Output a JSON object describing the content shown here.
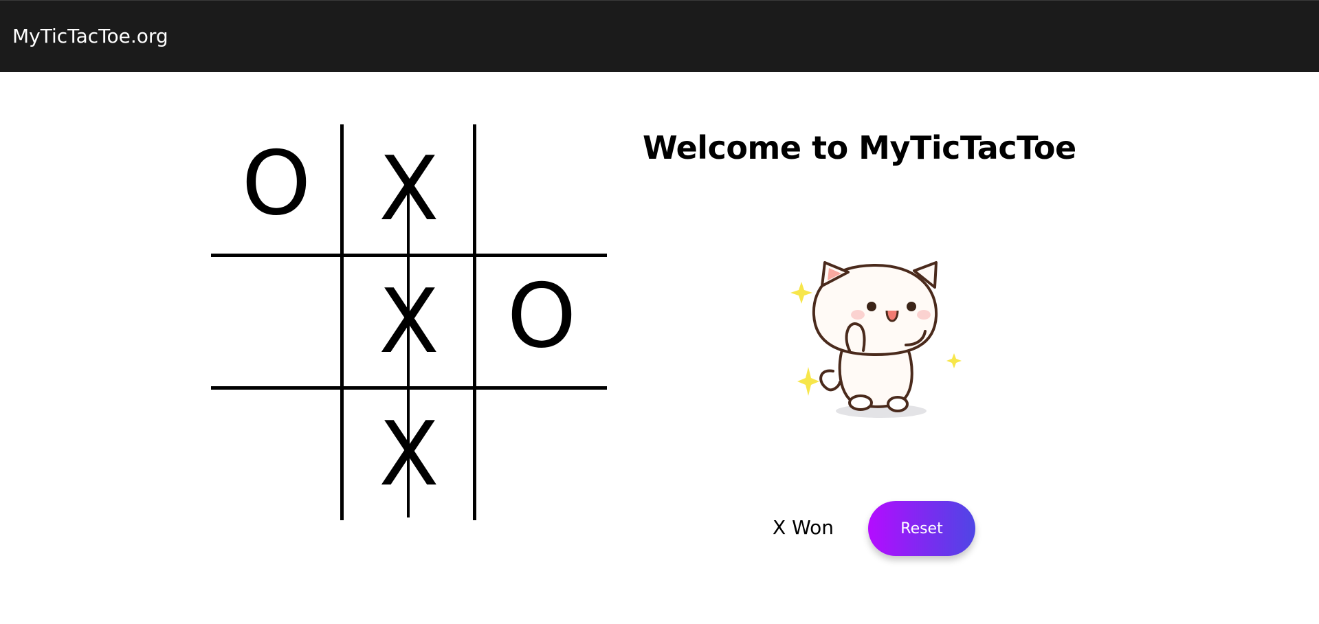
{
  "header": {
    "brand": "MyTicTacToe.org"
  },
  "board": {
    "cells": [
      "O",
      "X",
      "",
      "",
      "X",
      "O",
      "",
      "X",
      ""
    ],
    "winning_line": "middle-column"
  },
  "main": {
    "title": "Welcome to MyTicTacToe",
    "mascot_icon": "dancing-cat-icon",
    "status": "X Won",
    "reset_label": "Reset"
  },
  "colors": {
    "header_bg": "#1b1b1b",
    "button_gradient_start": "#b40cff",
    "button_gradient_end": "#4f46e5",
    "sparkle": "#f7e64a"
  }
}
